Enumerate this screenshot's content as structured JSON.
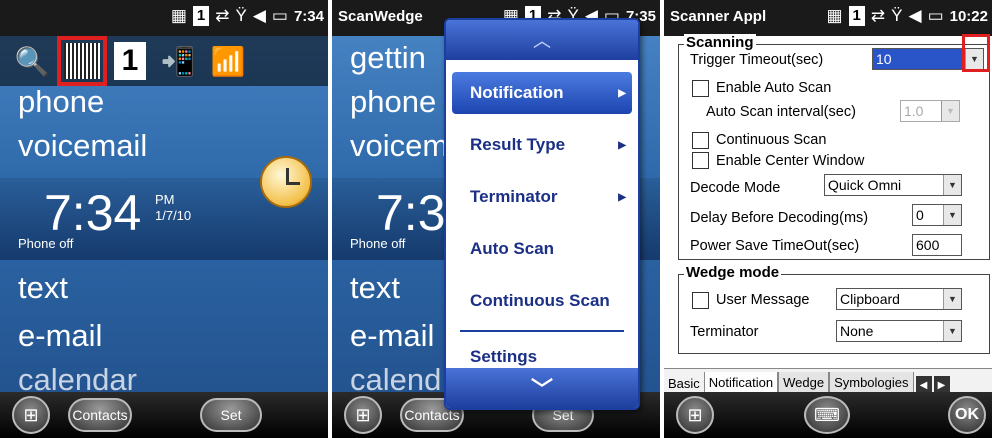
{
  "panel1": {
    "status": {
      "num": "1",
      "time": "7:34"
    },
    "tiles": {
      "item1": "phone",
      "item2": "voicemail",
      "item3": "text",
      "item4": "e-mail",
      "item5": "calendar"
    },
    "clock": {
      "time": "7:34",
      "ampm": "PM",
      "date": "1/7/10",
      "status": "Phone off"
    },
    "tray_one": "1",
    "bottom": {
      "contacts": "Contacts",
      "set": "Set"
    }
  },
  "panel2": {
    "status": {
      "title": "ScanWedge",
      "num": "1",
      "time": "7:35"
    },
    "bg_tiles": {
      "item0": "gettin",
      "item1": "phone",
      "item2": "voicem",
      "item3": "text",
      "item4": "e-mail",
      "item5": "calend"
    },
    "bg_clock": {
      "time": "7:3",
      "status": "Phone off"
    },
    "menu": {
      "items": [
        "Notification",
        "Result Type",
        "Terminator",
        "Auto Scan",
        "Continuous Scan",
        "Settings"
      ]
    },
    "bottom": {
      "contacts": "Contacts",
      "set": "Set"
    }
  },
  "panel3": {
    "status": {
      "title": "Scanner Appl",
      "num": "1",
      "time": "10:22"
    },
    "scanning": {
      "legend": "Scanning",
      "trigger_label": "Trigger Timeout(sec)",
      "trigger_value": "10",
      "enable_auto_scan": "Enable Auto Scan",
      "auto_interval_label": "Auto Scan interval(sec)",
      "auto_interval_value": "1.0",
      "continuous_scan": "Continuous Scan",
      "enable_center": "Enable Center Window",
      "decode_mode_label": "Decode Mode",
      "decode_mode_value": "Quick Omni",
      "delay_label": "Delay Before Decoding(ms)",
      "delay_value": "0",
      "power_label": "Power Save TimeOut(sec)",
      "power_value": "600"
    },
    "wedge": {
      "legend": "Wedge mode",
      "user_message": "User Message",
      "user_message_value": "Clipboard",
      "terminator_label": "Terminator",
      "terminator_value": "None"
    },
    "tabs": [
      "Basic",
      "Notification",
      "Wedge",
      "Symbologies"
    ],
    "ok": "OK"
  }
}
